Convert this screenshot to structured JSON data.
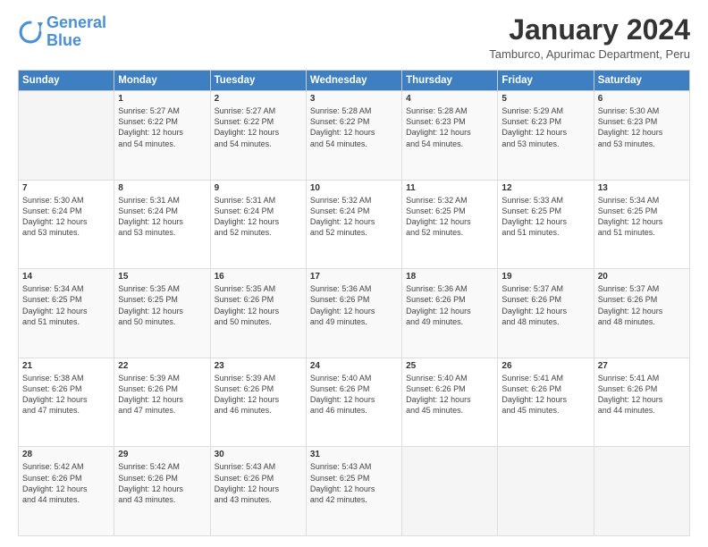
{
  "header": {
    "logo_line1": "General",
    "logo_line2": "Blue",
    "title": "January 2024",
    "location": "Tamburco, Apurimac Department, Peru"
  },
  "days_of_week": [
    "Sunday",
    "Monday",
    "Tuesday",
    "Wednesday",
    "Thursday",
    "Friday",
    "Saturday"
  ],
  "weeks": [
    [
      {
        "day": "",
        "content": ""
      },
      {
        "day": "1",
        "content": "Sunrise: 5:27 AM\nSunset: 6:22 PM\nDaylight: 12 hours\nand 54 minutes."
      },
      {
        "day": "2",
        "content": "Sunrise: 5:27 AM\nSunset: 6:22 PM\nDaylight: 12 hours\nand 54 minutes."
      },
      {
        "day": "3",
        "content": "Sunrise: 5:28 AM\nSunset: 6:22 PM\nDaylight: 12 hours\nand 54 minutes."
      },
      {
        "day": "4",
        "content": "Sunrise: 5:28 AM\nSunset: 6:23 PM\nDaylight: 12 hours\nand 54 minutes."
      },
      {
        "day": "5",
        "content": "Sunrise: 5:29 AM\nSunset: 6:23 PM\nDaylight: 12 hours\nand 53 minutes."
      },
      {
        "day": "6",
        "content": "Sunrise: 5:30 AM\nSunset: 6:23 PM\nDaylight: 12 hours\nand 53 minutes."
      }
    ],
    [
      {
        "day": "7",
        "content": "Sunrise: 5:30 AM\nSunset: 6:24 PM\nDaylight: 12 hours\nand 53 minutes."
      },
      {
        "day": "8",
        "content": "Sunrise: 5:31 AM\nSunset: 6:24 PM\nDaylight: 12 hours\nand 53 minutes."
      },
      {
        "day": "9",
        "content": "Sunrise: 5:31 AM\nSunset: 6:24 PM\nDaylight: 12 hours\nand 52 minutes."
      },
      {
        "day": "10",
        "content": "Sunrise: 5:32 AM\nSunset: 6:24 PM\nDaylight: 12 hours\nand 52 minutes."
      },
      {
        "day": "11",
        "content": "Sunrise: 5:32 AM\nSunset: 6:25 PM\nDaylight: 12 hours\nand 52 minutes."
      },
      {
        "day": "12",
        "content": "Sunrise: 5:33 AM\nSunset: 6:25 PM\nDaylight: 12 hours\nand 51 minutes."
      },
      {
        "day": "13",
        "content": "Sunrise: 5:34 AM\nSunset: 6:25 PM\nDaylight: 12 hours\nand 51 minutes."
      }
    ],
    [
      {
        "day": "14",
        "content": "Sunrise: 5:34 AM\nSunset: 6:25 PM\nDaylight: 12 hours\nand 51 minutes."
      },
      {
        "day": "15",
        "content": "Sunrise: 5:35 AM\nSunset: 6:25 PM\nDaylight: 12 hours\nand 50 minutes."
      },
      {
        "day": "16",
        "content": "Sunrise: 5:35 AM\nSunset: 6:26 PM\nDaylight: 12 hours\nand 50 minutes."
      },
      {
        "day": "17",
        "content": "Sunrise: 5:36 AM\nSunset: 6:26 PM\nDaylight: 12 hours\nand 49 minutes."
      },
      {
        "day": "18",
        "content": "Sunrise: 5:36 AM\nSunset: 6:26 PM\nDaylight: 12 hours\nand 49 minutes."
      },
      {
        "day": "19",
        "content": "Sunrise: 5:37 AM\nSunset: 6:26 PM\nDaylight: 12 hours\nand 48 minutes."
      },
      {
        "day": "20",
        "content": "Sunrise: 5:37 AM\nSunset: 6:26 PM\nDaylight: 12 hours\nand 48 minutes."
      }
    ],
    [
      {
        "day": "21",
        "content": "Sunrise: 5:38 AM\nSunset: 6:26 PM\nDaylight: 12 hours\nand 47 minutes."
      },
      {
        "day": "22",
        "content": "Sunrise: 5:39 AM\nSunset: 6:26 PM\nDaylight: 12 hours\nand 47 minutes."
      },
      {
        "day": "23",
        "content": "Sunrise: 5:39 AM\nSunset: 6:26 PM\nDaylight: 12 hours\nand 46 minutes."
      },
      {
        "day": "24",
        "content": "Sunrise: 5:40 AM\nSunset: 6:26 PM\nDaylight: 12 hours\nand 46 minutes."
      },
      {
        "day": "25",
        "content": "Sunrise: 5:40 AM\nSunset: 6:26 PM\nDaylight: 12 hours\nand 45 minutes."
      },
      {
        "day": "26",
        "content": "Sunrise: 5:41 AM\nSunset: 6:26 PM\nDaylight: 12 hours\nand 45 minutes."
      },
      {
        "day": "27",
        "content": "Sunrise: 5:41 AM\nSunset: 6:26 PM\nDaylight: 12 hours\nand 44 minutes."
      }
    ],
    [
      {
        "day": "28",
        "content": "Sunrise: 5:42 AM\nSunset: 6:26 PM\nDaylight: 12 hours\nand 44 minutes."
      },
      {
        "day": "29",
        "content": "Sunrise: 5:42 AM\nSunset: 6:26 PM\nDaylight: 12 hours\nand 43 minutes."
      },
      {
        "day": "30",
        "content": "Sunrise: 5:43 AM\nSunset: 6:26 PM\nDaylight: 12 hours\nand 43 minutes."
      },
      {
        "day": "31",
        "content": "Sunrise: 5:43 AM\nSunset: 6:25 PM\nDaylight: 12 hours\nand 42 minutes."
      },
      {
        "day": "",
        "content": ""
      },
      {
        "day": "",
        "content": ""
      },
      {
        "day": "",
        "content": ""
      }
    ]
  ]
}
